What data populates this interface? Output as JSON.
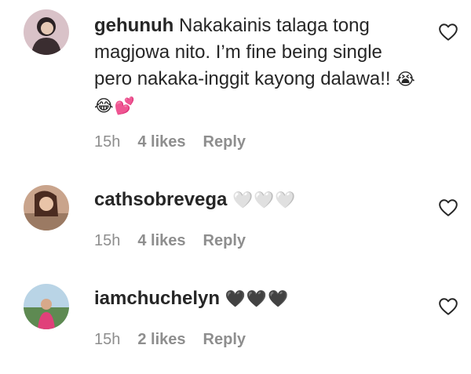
{
  "comments": [
    {
      "username": "gehunuh",
      "text": "Nakakainis talaga tong magjowa nito. I’m fine being single pero nakaka-inggit kayong dalawa!!",
      "emoji": "😭😂💕",
      "time": "15h",
      "likes": "4 likes",
      "reply": "Reply",
      "avatar_icon": "avatar-photo",
      "like_icon": "heart-outline-icon"
    },
    {
      "username": "cathsobrevega",
      "text": "",
      "emoji": "🤍🤍🤍",
      "time": "15h",
      "likes": "4 likes",
      "reply": "Reply",
      "avatar_icon": "avatar-photo",
      "like_icon": "heart-outline-icon"
    },
    {
      "username": "iamchuchelyn",
      "text": "",
      "emoji": "🖤🖤🖤",
      "time": "15h",
      "likes": "2 likes",
      "reply": "Reply",
      "avatar_icon": "avatar-photo",
      "like_icon": "heart-outline-icon"
    }
  ],
  "colors": {
    "text": "#262626",
    "meta": "#8e8e8e",
    "background": "#ffffff"
  }
}
